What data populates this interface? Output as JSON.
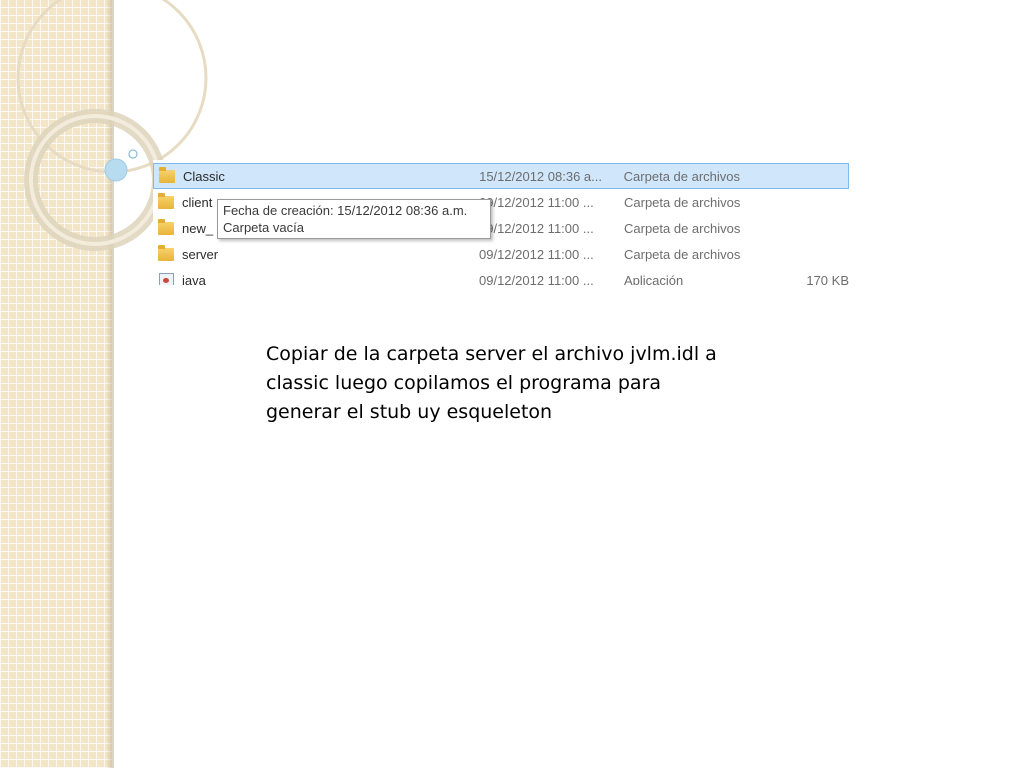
{
  "explorer": {
    "rows": [
      {
        "icon": "folder-icon",
        "name": "Classic",
        "date": "15/12/2012 08:36 a...",
        "type": "Carpeta de archivos",
        "size": "",
        "selected": true
      },
      {
        "icon": "folder-icon",
        "name": "client",
        "date": "09/12/2012 11:00 ...",
        "type": "Carpeta de archivos",
        "size": ""
      },
      {
        "icon": "folder-icon",
        "name": "new_",
        "date": "09/12/2012 11:00 ...",
        "type": "Carpeta de archivos",
        "size": ""
      },
      {
        "icon": "folder-icon",
        "name": "server",
        "date": "09/12/2012 11:00 ...",
        "type": "Carpeta de archivos",
        "size": ""
      },
      {
        "icon": "application-icon",
        "name": "java",
        "date": "09/12/2012 11:00 ...",
        "type": "Aplicación",
        "size": "170 KB"
      }
    ],
    "tooltip": {
      "line1": "Fecha de creación: 15/12/2012 08:36 a.m.",
      "line2": "Carpeta vacía"
    },
    "selection_color": "#cfe6fb",
    "selection_border": "#80b9ee"
  },
  "caption": {
    "line1": "Copiar de la carpeta server el archivo jvlm.idl a",
    "line2": "classic luego copilamos el programa para",
    "line3": "generar el stub uy esqueleton"
  },
  "theme": {
    "band_color": "#f3e6c8",
    "accent_bubble": "#b8dcef"
  }
}
